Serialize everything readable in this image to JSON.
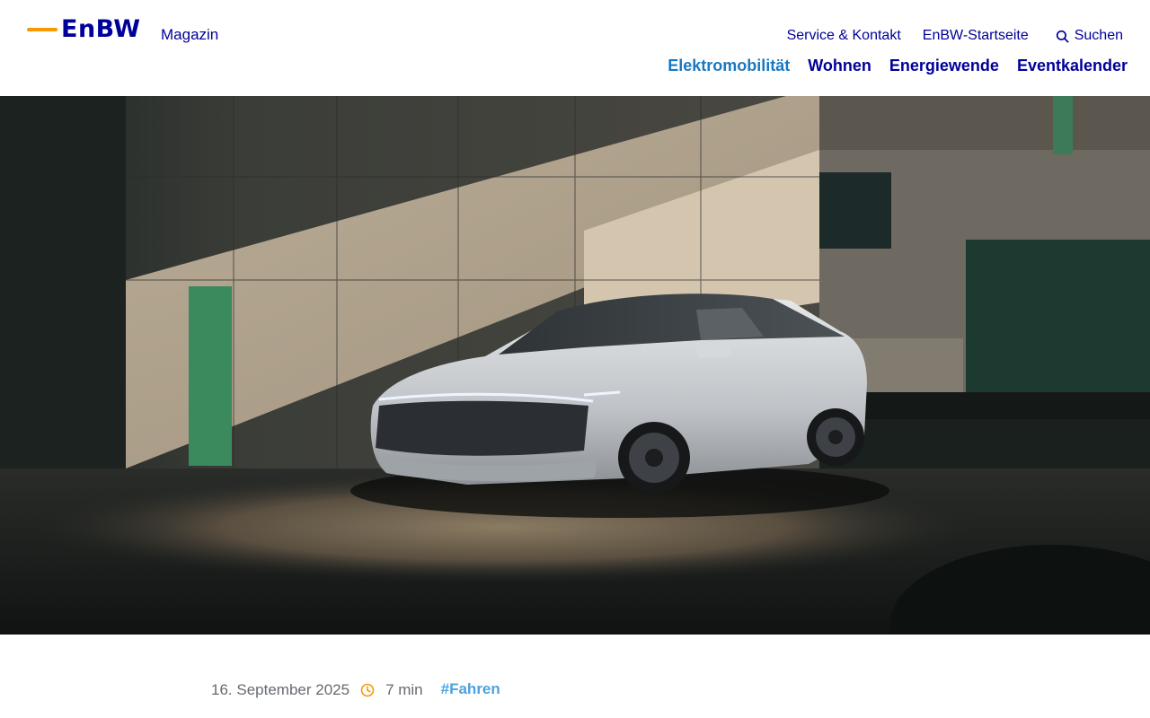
{
  "header": {
    "logo_text": "EnBW",
    "section_label": "Magazin",
    "meta_links": [
      {
        "label": "Service & Kontakt"
      },
      {
        "label": "EnBW-Startseite"
      }
    ],
    "search_label": "Suchen",
    "main_nav": [
      {
        "label": "Elektromobilität",
        "active": true
      },
      {
        "label": "Wohnen",
        "active": false
      },
      {
        "label": "Energiewende",
        "active": false
      },
      {
        "label": "Eventkalender",
        "active": false
      }
    ]
  },
  "hero": {
    "image_subject": "white electric concept car in front of a concrete wall"
  },
  "article_meta": {
    "date": "16. September 2025",
    "read_time": "7 min",
    "tag": "#Fahren"
  },
  "colors": {
    "brand": "#000099",
    "accent_orange": "#f59a00",
    "active_nav": "#1a78c2",
    "tag": "#4aa3df",
    "muted_text": "#666a70"
  },
  "icons": {
    "search": "search-icon",
    "clock": "clock-icon"
  }
}
